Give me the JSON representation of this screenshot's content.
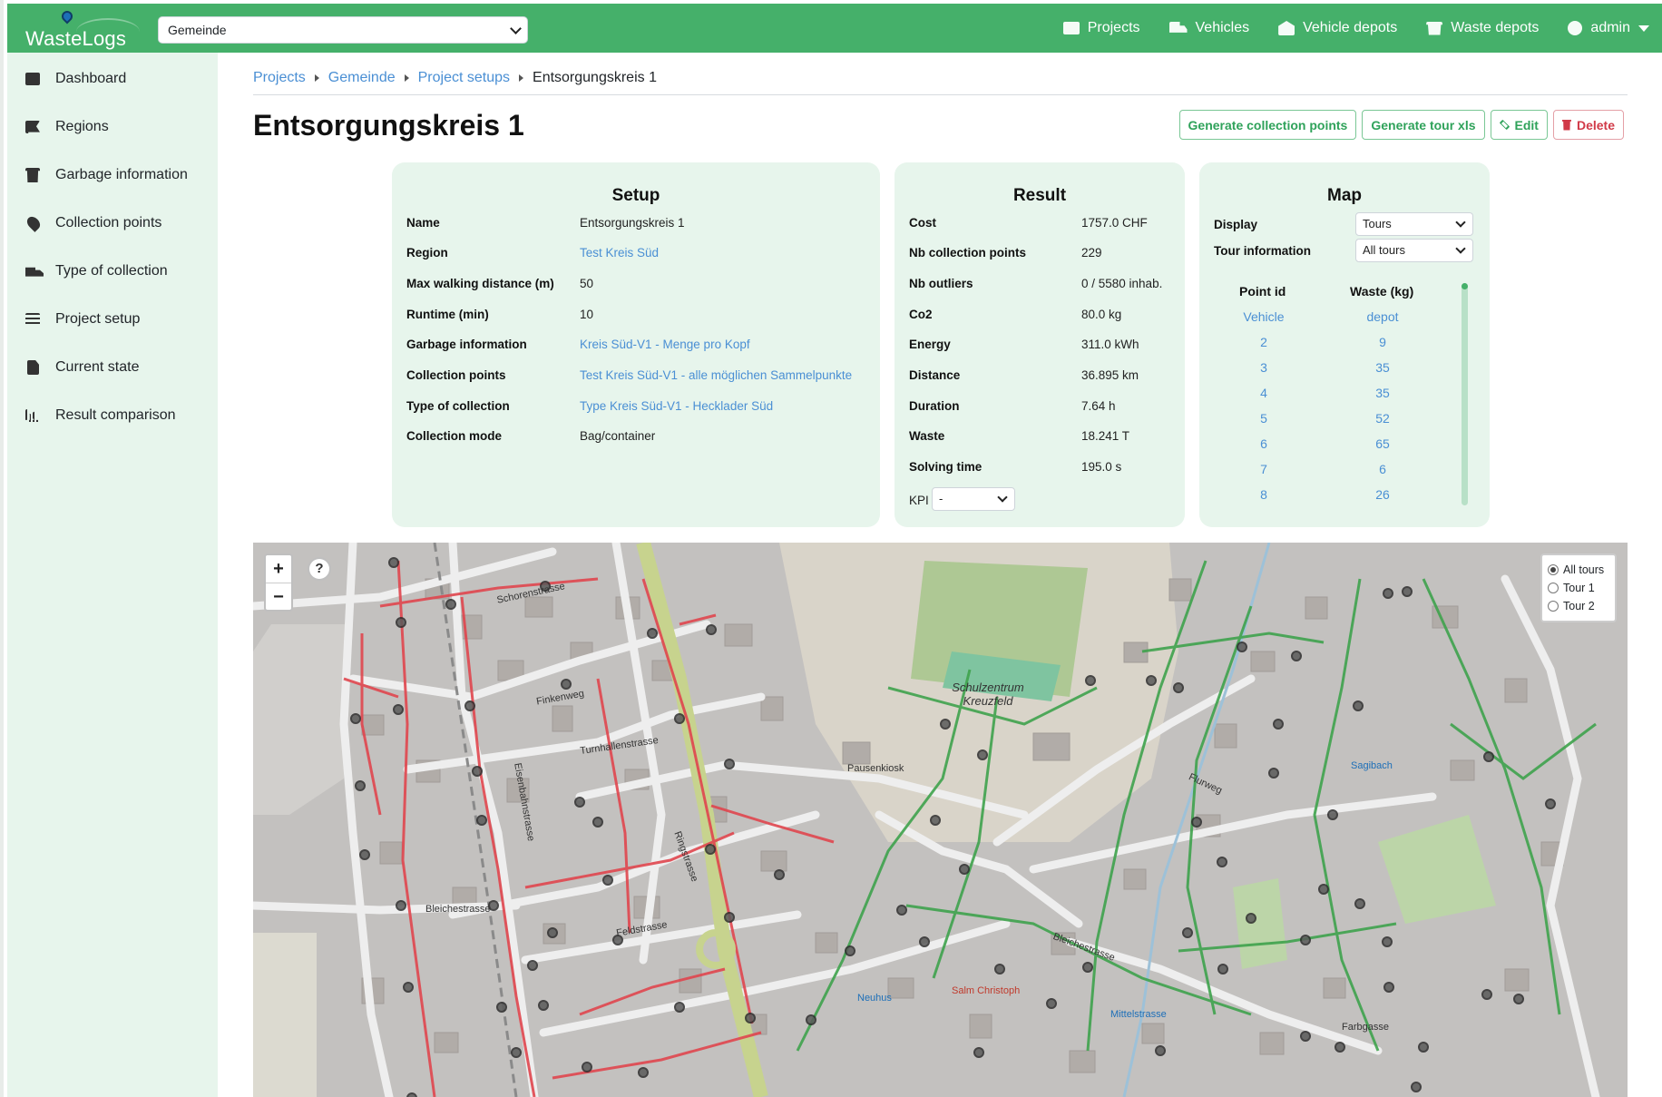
{
  "navbar": {
    "brand": "WasteLogs",
    "municipality": "Gemeinde",
    "links": [
      {
        "label": "Projects",
        "icon": "table-icon"
      },
      {
        "label": "Vehicles",
        "icon": "truck-icon"
      },
      {
        "label": "Vehicle depots",
        "icon": "warehouse-icon"
      },
      {
        "label": "Waste depots",
        "icon": "dumpster-icon"
      },
      {
        "label": "admin",
        "icon": "user-circle-icon"
      }
    ]
  },
  "sidebar": {
    "items": [
      {
        "label": "Dashboard",
        "icon": "table-icon"
      },
      {
        "label": "Regions",
        "icon": "flag-icon"
      },
      {
        "label": "Garbage information",
        "icon": "trash-icon"
      },
      {
        "label": "Collection points",
        "icon": "map-pin-icon"
      },
      {
        "label": "Type of collection",
        "icon": "dolly-icon"
      },
      {
        "label": "Project setup",
        "icon": "sliders-icon"
      },
      {
        "label": "Current state",
        "icon": "file-icon"
      },
      {
        "label": "Result comparison",
        "icon": "bar-chart-icon"
      }
    ]
  },
  "breadcrumb": [
    "Projects",
    "Gemeinde",
    "Project setups",
    "Entsorgungskreis 1"
  ],
  "page": {
    "title": "Entsorgungskreis 1",
    "actions": {
      "generate_points": "Generate collection points",
      "generate_tour": "Generate tour xls",
      "edit": "Edit",
      "delete": "Delete"
    }
  },
  "setup": {
    "title": "Setup",
    "rows": [
      {
        "key": "Name",
        "value": "Entsorgungskreis 1",
        "link": false
      },
      {
        "key": "Region",
        "value": "Test Kreis Süd",
        "link": true
      },
      {
        "key": "Max walking distance (m)",
        "value": "50",
        "link": false
      },
      {
        "key": "Runtime (min)",
        "value": "10",
        "link": false
      },
      {
        "key": "Garbage information",
        "value": "Kreis Süd-V1 - Menge pro Kopf",
        "link": true
      },
      {
        "key": "Collection points",
        "value": "Test Kreis Süd-V1 - alle möglichen Sammelpunkte",
        "link": true
      },
      {
        "key": "Type of collection",
        "value": "Type Kreis Süd-V1 - Hecklader Süd",
        "link": true
      },
      {
        "key": "Collection mode",
        "value": "Bag/container",
        "link": false
      }
    ]
  },
  "result": {
    "title": "Result",
    "rows": [
      {
        "key": "Cost",
        "value": "1757.0 CHF"
      },
      {
        "key": "Nb collection points",
        "value": "229"
      },
      {
        "key": "Nb outliers",
        "value": "0 / 5580 inhab."
      },
      {
        "key": "Co2",
        "value": "80.0 kg"
      },
      {
        "key": "Energy",
        "value": "311.0 kWh"
      },
      {
        "key": "Distance",
        "value": "36.895 km"
      },
      {
        "key": "Duration",
        "value": "7.64 h"
      },
      {
        "key": "Waste",
        "value": "18.241 T"
      },
      {
        "key": "Solving time",
        "value": "195.0 s"
      }
    ],
    "kpi_label": "KPI",
    "kpi_value": "-"
  },
  "mapcard": {
    "title": "Map",
    "display_label": "Display",
    "display_value": "Tours",
    "tour_info_label": "Tour information",
    "tour_info_value": "All tours",
    "col_point": "Point id",
    "col_waste": "Waste (kg)",
    "rows": [
      {
        "point": "Vehicle",
        "waste": "depot"
      },
      {
        "point": "2",
        "waste": "9"
      },
      {
        "point": "3",
        "waste": "35"
      },
      {
        "point": "4",
        "waste": "35"
      },
      {
        "point": "5",
        "waste": "52"
      },
      {
        "point": "6",
        "waste": "65"
      },
      {
        "point": "7",
        "waste": "6"
      },
      {
        "point": "8",
        "waste": "26"
      }
    ]
  },
  "map": {
    "zoom_in": "+",
    "zoom_out": "−",
    "help": "?",
    "tour_options": [
      {
        "label": "All tours",
        "checked": true
      },
      {
        "label": "Tour 1",
        "checked": false
      },
      {
        "label": "Tour 2",
        "checked": false
      }
    ],
    "labels": [
      "Schorenstrasse",
      "Finkenweg",
      "Turnhallenstrasse",
      "Ringstrasse",
      "Bleichestrasse",
      "Feldstrasse",
      "Eisenbahnstrasse",
      "Schulzentrum Kreuzfeld",
      "Pausenkiosk",
      "Flurweg",
      "Farbgasse",
      "Sagibach",
      "Bleichestrasse",
      "Mittelstrasse",
      "Salm Christoph",
      "Neuhus"
    ],
    "colors": {
      "tour1": "#e0464e",
      "tour2": "#3fa34d",
      "stop": "#4a4a4a"
    }
  }
}
